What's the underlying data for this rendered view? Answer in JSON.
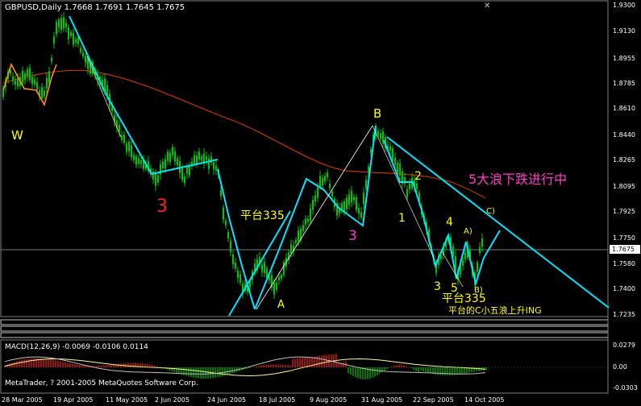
{
  "window": {
    "symbol_line": "GBPUSD,Daily  1.7668 1.7691 1.7645 1.7675",
    "close_icon": "close-icon"
  },
  "price_axis": {
    "labels": [
      "1.9300",
      "1.9130",
      "1.8955",
      "1.8785",
      "1.8610",
      "1.8440",
      "1.8265",
      "1.8095",
      "1.7925",
      "1.7750",
      "1.7580",
      "1.7400",
      "1.7235"
    ],
    "current": "1.7675"
  },
  "macd_axis": {
    "labels": [
      "0.0279",
      "0.00",
      "-0.0303"
    ]
  },
  "date_axis": {
    "labels": [
      "28 Mar 2005",
      "19 Apr 2005",
      "11 May 2005",
      "2 Jun 2005",
      "24 Jun 2005",
      "18 Jul 2005",
      "9 Aug 2005",
      "31 Aug 2005",
      "22 Sep 2005",
      "14 Oct 2005"
    ]
  },
  "macd": {
    "label": "MACD(12,26,9) -0.0069 -0.0106 0.0114"
  },
  "footer": {
    "copyright": "MetaTrader, ? 2001-2005 MetaQuotes Software Corp."
  },
  "annotations": {
    "w": "W",
    "three_red": "3",
    "platform_left": "平台335",
    "a": "A",
    "three_pink": "3",
    "b": "B",
    "one": "1",
    "two": "2",
    "three_y": "3",
    "four": "4",
    "five": "5",
    "a_paren": "A)",
    "b_paren": "B)",
    "c_paren": "C)",
    "platform_right": "平台335",
    "rise_note": "平台的C小五浪上升ING",
    "headline": "5大浪下跌进行中"
  },
  "colors": {
    "background": "#000000",
    "candle": "#00c800",
    "wave_line": "#00e5ff",
    "ma_line": "#c83200",
    "zigzag_orange": "#ff8c1a",
    "label_yellow": "#ffff00",
    "label_red": "#ff2020",
    "label_pink": "#ff3cc8",
    "macd_hist_up": "#ff2020",
    "macd_hist_down": "#00c800",
    "signal_line": "#ffff80",
    "macd_line": "#c0c0c0"
  },
  "chart_data": {
    "type": "line",
    "title": "GBPUSD,Daily",
    "x": [
      "28 Mar 2005",
      "19 Apr 2005",
      "11 May 2005",
      "2 Jun 2005",
      "24 Jun 2005",
      "18 Jul 2005",
      "9 Aug 2005",
      "31 Aug 2005",
      "22 Sep 2005",
      "14 Oct 2005"
    ],
    "series": [
      {
        "name": "GBPUSD",
        "values": [
          1.885,
          1.915,
          1.84,
          1.825,
          1.76,
          1.735,
          1.805,
          1.85,
          1.755,
          1.7675
        ]
      }
    ],
    "ylim": [
      1.7235,
      1.93
    ],
    "grid": false,
    "last": {
      "open": 1.7668,
      "high": 1.7691,
      "low": 1.7645,
      "close": 1.7675
    },
    "macd": {
      "params": "12,26,9",
      "values": [
        -0.0069,
        -0.0106,
        0.0114
      ],
      "ylim": [
        -0.0303,
        0.0279
      ]
    }
  }
}
